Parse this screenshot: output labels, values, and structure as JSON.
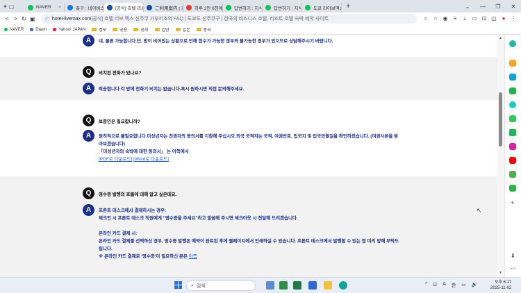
{
  "tabs": [
    {
      "label": "NAVER",
      "color": "#03c75a"
    },
    {
      "label": "축구 : 네이버스포츠",
      "color": "#1a73e8"
    },
    {
      "label": "[공식] 호텔 리브 맥",
      "color": "#1a4b9c",
      "active": true
    },
    {
      "label": "ご利用案内 | 호텔",
      "color": "#1a4b9c"
    },
    {
      "label": "하루 2만 6천에 묵...",
      "color": "#e53935"
    },
    {
      "label": "답변하기 : 지식iN",
      "color": "#03c75a"
    },
    {
      "label": "답변하기 : 지식iN",
      "color": "#03c75a"
    },
    {
      "label": "도쿄 라이브맥스 리",
      "color": "#03c75a"
    }
  ],
  "newtab": "+",
  "window_controls": [
    "⌄",
    "—",
    "❐",
    "✕"
  ],
  "address": {
    "domain": "hotel-livemax.com",
    "rest": " [공식] 호텔 리브 맥스 신주쿠 가부키초의 FAQ | 도쿄도 신주쿠구 | 한국의 비즈니스 호텔, 리조트 호텔 숙박 예약 사이트"
  },
  "bookmarks": [
    {
      "label": "NAVER",
      "type": "dot",
      "color": "#03c75a"
    },
    {
      "label": "Daum",
      "type": "dot",
      "color": "#3b5bdb"
    },
    {
      "label": "Yahoo! JAPAN",
      "type": "dot",
      "color": "#ff0033"
    },
    {
      "label": "정보",
      "type": "folder"
    },
    {
      "label": "공용",
      "type": "folder"
    },
    {
      "label": "공지",
      "type": "folder"
    },
    {
      "label": "일반",
      "type": "folder"
    },
    {
      "label": "일본",
      "type": "folder"
    },
    {
      "label": "중국",
      "type": "folder"
    }
  ],
  "faq": {
    "a0": "네, 물론 가능합니다.단, 방이 비어있는 상황으로 인해 접수가 가능한 경우와 불가능한 경우가 있으므로 상담해주시기 바랍니다.",
    "q1": "비치된 전화가 있나요?",
    "a1": "죄송합니다.각 방에 전화기 비치는 없습니다.혹시 원하시면 직접 문의해주세요.",
    "q2": "보증인은 필요합니까?",
    "a2_line1": "원칙적으로 불필요합니다.미성년자는 친권자의 동의서를 지참해 주십시오.외국 국적자는 국적, 여권번호, 입국지 및 입국연월일을 확인하겠습니다. (여권사본을 받",
    "a2_line2": "아보겠습니다)",
    "a2_line3": "「미성년자의 숙박에 대한 동의서」 는 이쪽에서",
    "a2_link1": "[PDF로 다운로드]",
    "a2_link2": "[Word로 다운로드]",
    "q3": "영수증 발행의 흐름에 대해 알고 싶은데요.",
    "a3_l1": "프론트 데스크에서 결제하시는 경우:",
    "a3_l2": "체크인 시 프론트 데스크 직원에게 \"영수증을 주세요\"라고 말씀해 주시면 체크아웃 시 전달해 드리겠습니다.",
    "a3_l3": "온라인 카드 결제 시:",
    "a3_l4": "온라인 카드 결제를 선택하신 경우, 영수증 발행은 예약이 완료된 후에 웹페이지에서 인쇄하실 수 있습니다. 프론트 데스크에서 발행할 수 있는 점 미리 양해 부탁드",
    "a3_l5": "립니다.",
    "a3_l6": "※ 온라인 카드 결제로 '영수증'이 필요하신 분은 ",
    "a3_link": "이쪽",
    "q_label": "Q",
    "a_label": "A"
  },
  "taskbar": {
    "search_placeholder": "검색",
    "tray_items": [
      "^",
      "⊡",
      "A",
      "한",
      "▭",
      "🔊"
    ],
    "time": "오후 6:17",
    "date": "2025-11-02"
  }
}
